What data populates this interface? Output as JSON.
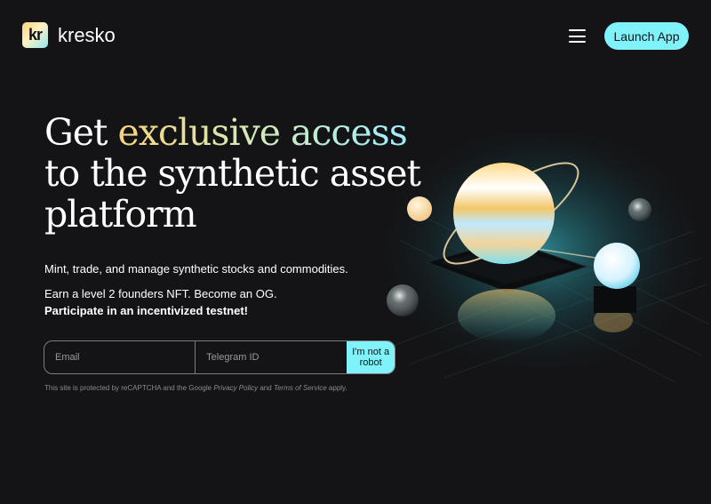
{
  "header": {
    "logo_mark": "kr",
    "logo_text": "kresko",
    "menu_icon": "hamburger-menu-icon",
    "launch_label": "Launch App"
  },
  "hero": {
    "title_prefix": "Get",
    "title_accent": "exclusive access",
    "title_line2": "to the synthetic asset",
    "title_line3": "platform",
    "line1": "Mint, trade, and manage synthetic stocks and commodities.",
    "line2": "Earn a level 2 founders NFT. Become an OG.",
    "line3": "Participate in an incentivized testnet!"
  },
  "form": {
    "email_placeholder": "Email",
    "telegram_placeholder": "Telegram ID",
    "captcha_label": "I'm not a robot"
  },
  "legal": {
    "prefix": "This site is protected by reCAPTCHA and the Google",
    "privacy_link": "Privacy Policy",
    "and": "and",
    "terms_link": "Terms of Service",
    "suffix": "apply."
  },
  "colors": {
    "background": "#141416",
    "accent_cyan": "#7ff3f9",
    "accent_gold": "#f6d47f"
  }
}
